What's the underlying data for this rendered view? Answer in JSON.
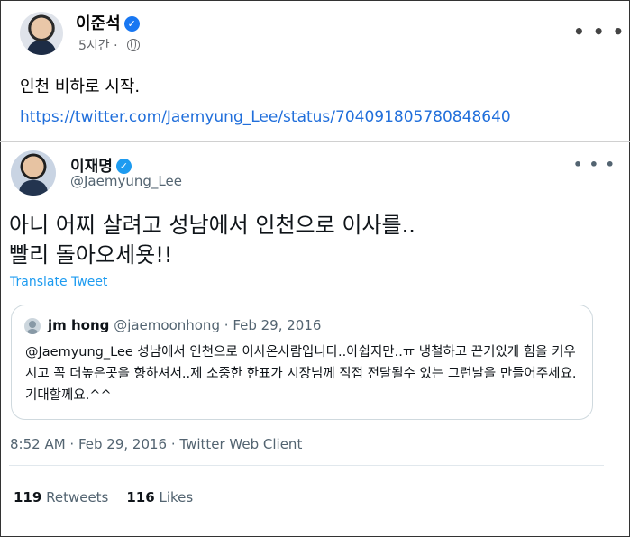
{
  "facebook_post": {
    "author": "이준석",
    "time": "5시간",
    "text": "인천 비하로 시작.",
    "link": "https://twitter.com/Jaemyung_Lee/status/704091805780848640"
  },
  "tweet": {
    "name": "이재명",
    "handle": "@Jaemyung_Lee",
    "body_line1": "아니 어찌 살려고 성남에서 인천으로 이사를..",
    "body_line2": "빨리 돌아오세욧!!",
    "translate": "Translate Tweet",
    "quote": {
      "name": "jm hong",
      "handle": "@jaemoonhong",
      "separator": "·",
      "date": "Feb 29, 2016",
      "text": "@Jaemyung_Lee 성남에서 인천으로 이사온사람입니다..아쉽지만..ㅠ 냉철하고 끈기있게 힘을 키우시고 꼭 더높은곳을 향하셔서..제 소중한 한표가 시장님께 직접 전달될수 있는 그런날을 만들어주세요.기대할께요.^^"
    },
    "timestamp": "8:52 AM · Feb 29, 2016 · Twitter Web Client",
    "retweets_count": "119",
    "retweets_label": "Retweets",
    "likes_count": "116",
    "likes_label": "Likes"
  },
  "colors": {
    "link": "#216fdb",
    "verified": "#1877f2",
    "twitter_blue": "#1d9bf0",
    "secondary_text": "#536471"
  },
  "icons": [
    "verified-badge-icon",
    "globe-icon",
    "more-options-icon",
    "default-avatar-icon"
  ]
}
